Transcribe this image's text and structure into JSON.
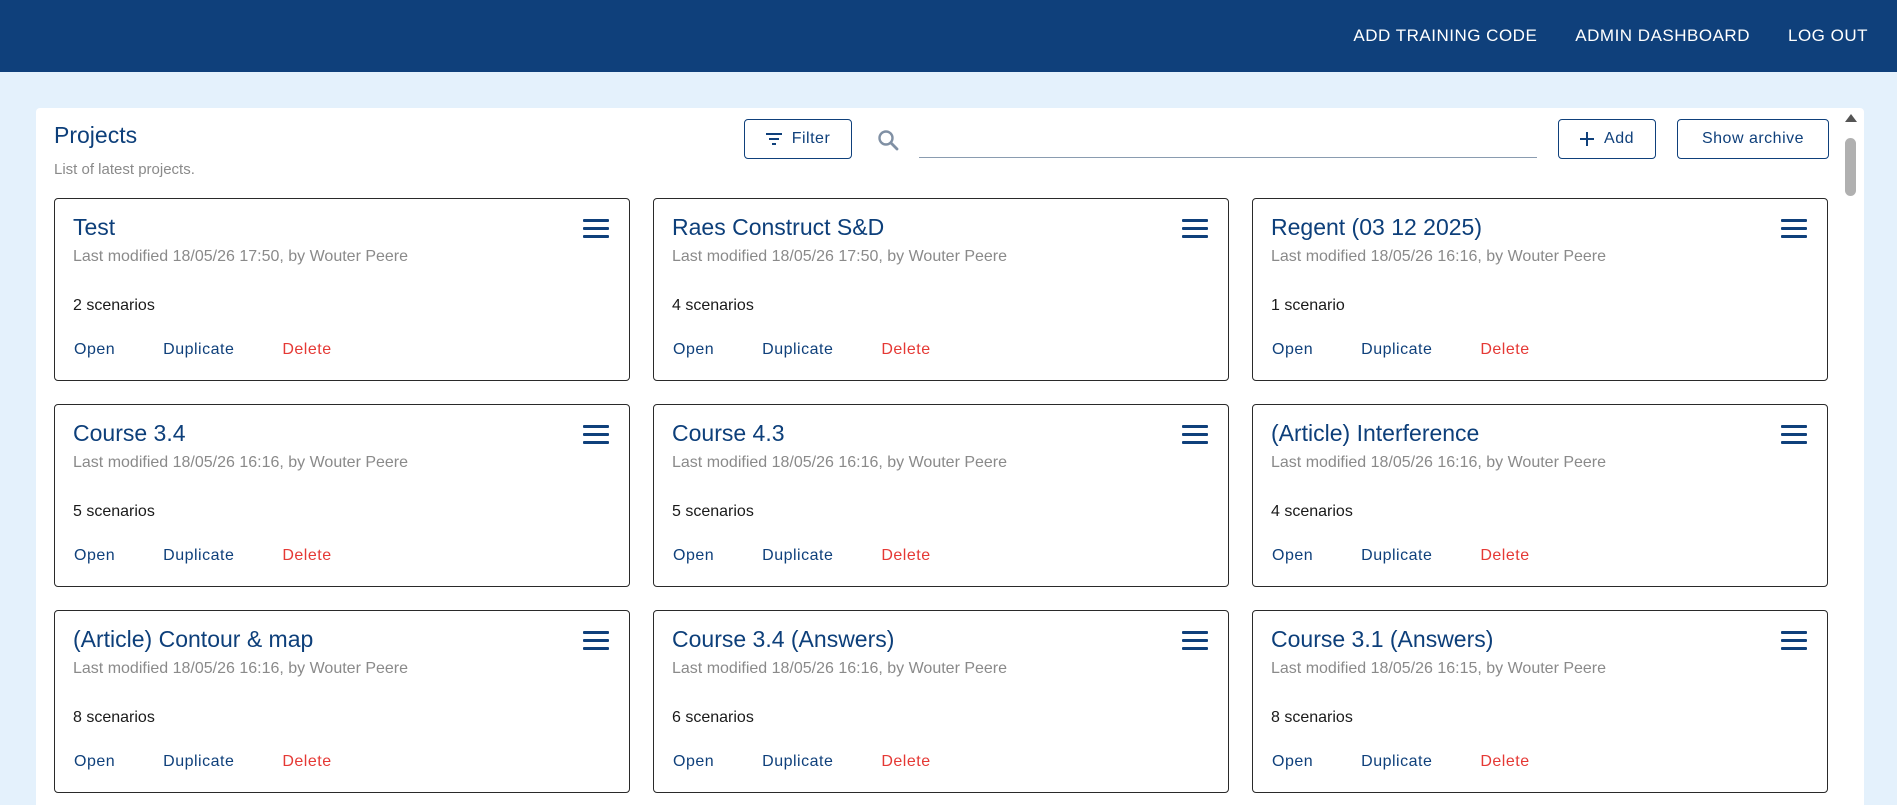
{
  "nav": {
    "add_training_code": "ADD TRAINING CODE",
    "admin_dashboard": "ADMIN DASHBOARD",
    "log_out": "LOG OUT"
  },
  "panel": {
    "title": "Projects",
    "subtitle": "List of latest projects.",
    "filter_label": "Filter",
    "add_label": "Add",
    "archive_label": "Show archive",
    "search_value": ""
  },
  "actions": {
    "open": "Open",
    "duplicate": "Duplicate",
    "delete": "Delete"
  },
  "projects": [
    {
      "title": "Test",
      "meta": "Last modified 18/05/26 17:50, by Wouter Peere",
      "count": "2 scenarios"
    },
    {
      "title": "Raes Construct S&D",
      "meta": "Last modified 18/05/26 17:50, by Wouter Peere",
      "count": "4 scenarios"
    },
    {
      "title": "Regent (03 12 2025)",
      "meta": "Last modified 18/05/26 16:16, by Wouter Peere",
      "count": "1 scenario"
    },
    {
      "title": "Course 3.4",
      "meta": "Last modified 18/05/26 16:16, by Wouter Peere",
      "count": "5 scenarios"
    },
    {
      "title": "Course 4.3",
      "meta": "Last modified 18/05/26 16:16, by Wouter Peere",
      "count": "5 scenarios"
    },
    {
      "title": "(Article) Interference",
      "meta": "Last modified 18/05/26 16:16, by Wouter Peere",
      "count": "4 scenarios"
    },
    {
      "title": "(Article) Contour & map",
      "meta": "Last modified 18/05/26 16:16, by Wouter Peere",
      "count": "8 scenarios"
    },
    {
      "title": "Course 3.4 (Answers)",
      "meta": "Last modified 18/05/26 16:16, by Wouter Peere",
      "count": "6 scenarios"
    },
    {
      "title": "Course 3.1 (Answers)",
      "meta": "Last modified 18/05/26 16:15, by Wouter Peere",
      "count": "8 scenarios"
    }
  ],
  "colors": {
    "header_bg": "#0f407b",
    "page_bg": "#e4f1fc",
    "primary": "#0f407b",
    "delete": "#e53935"
  },
  "icons": {
    "filter": "filter-list-icon",
    "search": "search-icon",
    "add": "plus-icon",
    "menu": "hamburger-menu-icon"
  }
}
